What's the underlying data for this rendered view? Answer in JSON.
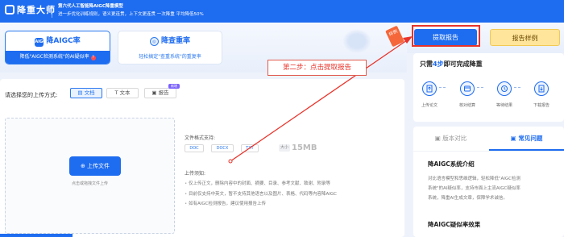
{
  "header": {
    "brand": "降重大师",
    "slogan_line1": "第六代人工智能降AIGC降重模型",
    "slogan_line2": "进一步优化训练规则，语义更连贯，上下文更连贯 一次降重 平均降低50%"
  },
  "products": [
    {
      "icon": "AIGC",
      "title": "降AIGC率",
      "subtitle": "降低\"AIGC检测系统\"的AI疑似率",
      "help": "?"
    },
    {
      "icon": "◎",
      "title": "降查重率",
      "subtitle": "轻松搞定\"查重系统\"的重复率"
    }
  ],
  "ribbon": "样例",
  "upload": {
    "method_label": "请选择您的上传方式:",
    "methods": [
      "文档",
      "文本",
      "报告"
    ],
    "new_badge": "新增",
    "button": "上传文件",
    "hint": "点击或拖拽文件上传",
    "format_label": "文件格式支持:",
    "formats": [
      "DOC",
      "DOCX",
      "TXT"
    ],
    "size_tag": "大小",
    "size_value": "15MB",
    "notice_title": "上传须知:",
    "notices": [
      "仅上传正文，删除内容中的封面、摘要、目录、参考文献、致谢、附录等",
      "目前仅支持中英文，暂不支持其他语言以及图片、表格、代码等内容降AIGC",
      "如有AIGC检测报告，建议使用报告上传"
    ]
  },
  "actions": {
    "extract": "提取报告",
    "sample": "报告样例"
  },
  "annotation": "第二步：点击提取报告",
  "steps": {
    "title_prefix": "只需",
    "title_num": "4步",
    "title_suffix": "即可完成降重",
    "items": [
      "上传论文",
      "核对结算",
      "等待结果",
      "下载报告"
    ]
  },
  "faq": {
    "tabs": [
      "版本对比",
      "常见问题"
    ],
    "q1": "降AIGC系统介绍",
    "a1": [
      "对比语言模型和思维逻辑，轻松降低\"AIGC检测",
      "系统\"的AI疑似率，支持市面上主流AIGC疑似率",
      "系统，降重AI生成文章，保障学术诚信。"
    ],
    "q2": "降AIGC疑似率效果"
  },
  "colors": {
    "primary": "#1e6cf0",
    "highlight": "#e8332a",
    "sample_button": "#ffe59b"
  }
}
